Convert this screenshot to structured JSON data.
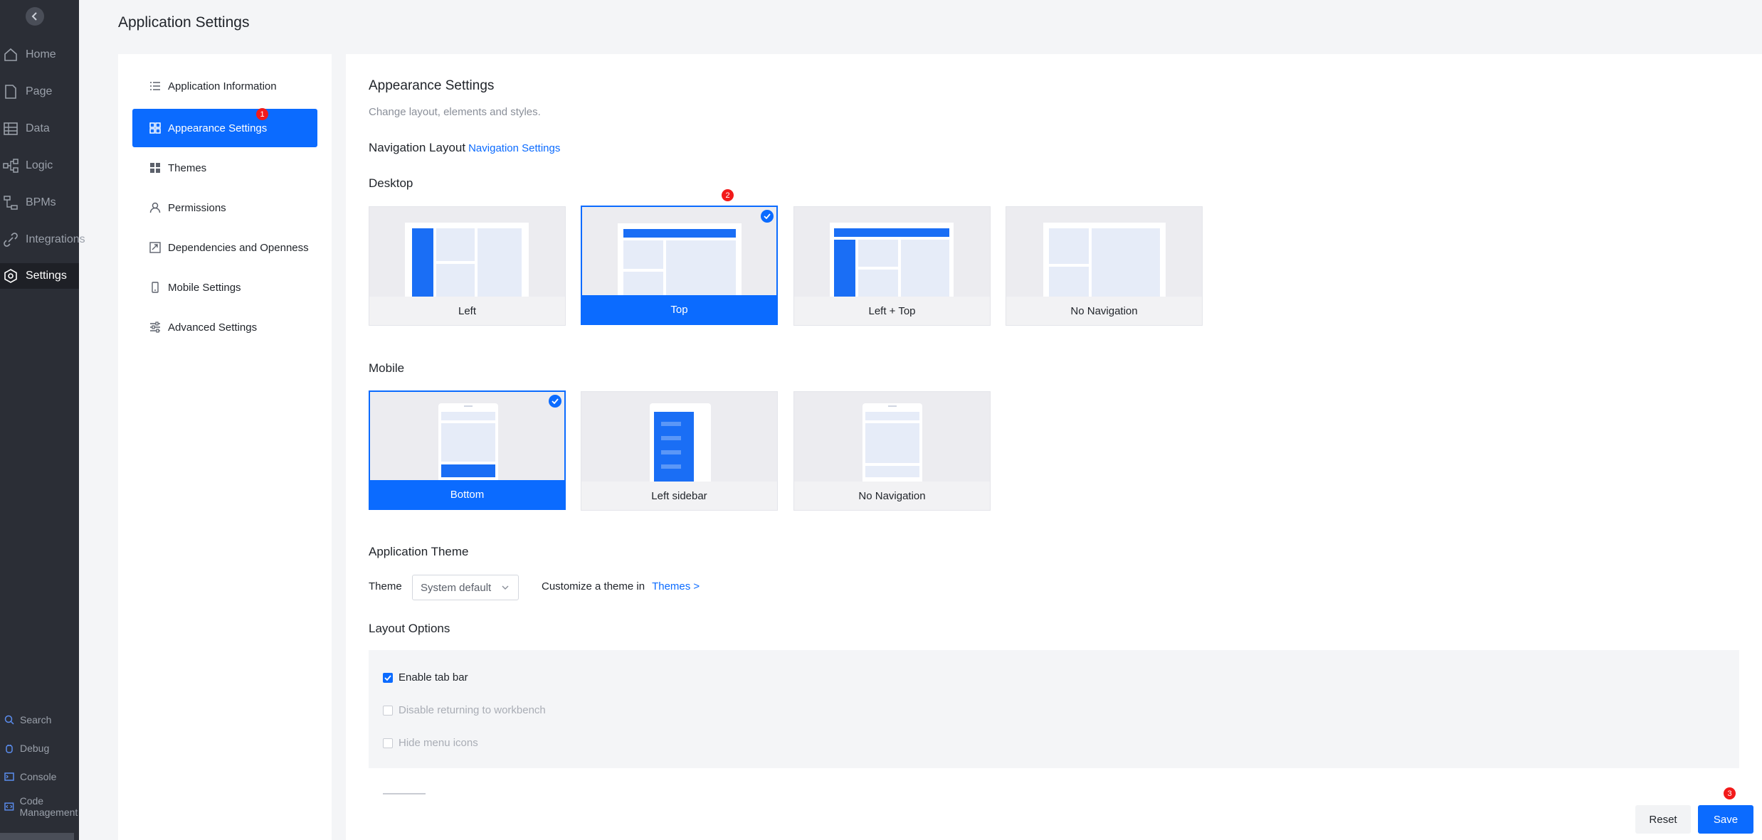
{
  "page_title": "Application Settings",
  "rail": {
    "items": [
      {
        "label": "Home",
        "icon": "home-icon"
      },
      {
        "label": "Page",
        "icon": "page-icon"
      },
      {
        "label": "Data",
        "icon": "data-icon"
      },
      {
        "label": "Logic",
        "icon": "logic-icon"
      },
      {
        "label": "BPMs",
        "icon": "bpms-icon"
      },
      {
        "label": "Integrations",
        "icon": "integrations-icon"
      },
      {
        "label": "Settings",
        "icon": "settings-icon"
      }
    ],
    "bottom": [
      {
        "label": "Search",
        "icon": "search-icon"
      },
      {
        "label": "Debug",
        "icon": "debug-icon"
      },
      {
        "label": "Console",
        "icon": "console-icon"
      },
      {
        "label": "Code Management",
        "icon": "code-management-icon"
      }
    ]
  },
  "settings_nav": {
    "items": [
      {
        "label": "Application Information",
        "icon": "list-icon"
      },
      {
        "label": "Appearance Settings",
        "icon": "layout-icon"
      },
      {
        "label": "Themes",
        "icon": "grid-icon"
      },
      {
        "label": "Permissions",
        "icon": "user-icon"
      },
      {
        "label": "Dependencies and Openness",
        "icon": "link-icon"
      },
      {
        "label": "Mobile Settings",
        "icon": "mobile-icon"
      },
      {
        "label": "Advanced Settings",
        "icon": "sliders-icon"
      }
    ],
    "active_index": 1
  },
  "annotations": {
    "badge1": "1",
    "badge2": "2",
    "badge3": "3"
  },
  "main": {
    "title": "Appearance Settings",
    "subtitle": "Change layout, elements and styles.",
    "nav_layout_label": "Navigation Layout",
    "nav_settings_link": "Navigation Settings",
    "desktop_label": "Desktop",
    "desktop_options": [
      {
        "label": "Left",
        "selected": false
      },
      {
        "label": "Top",
        "selected": true
      },
      {
        "label": "Left + Top",
        "selected": false
      },
      {
        "label": "No Navigation",
        "selected": false
      }
    ],
    "mobile_label": "Mobile",
    "mobile_options": [
      {
        "label": "Bottom",
        "selected": true
      },
      {
        "label": "Left sidebar",
        "selected": false
      },
      {
        "label": "No Navigation",
        "selected": false
      }
    ],
    "app_theme_label": "Application Theme",
    "theme_field_label": "Theme",
    "theme_value": "System default",
    "customize_text": "Customize a theme in",
    "themes_link": "Themes >",
    "layout_options_label": "Layout Options",
    "layout_options": [
      {
        "label": "Enable tab bar",
        "checked": true,
        "disabled": false
      },
      {
        "label": "Disable returning to workbench",
        "checked": false,
        "disabled": true
      },
      {
        "label": "Hide menu icons",
        "checked": false,
        "disabled": true
      }
    ],
    "reset_label": "Reset",
    "save_label": "Save"
  },
  "colors": {
    "accent": "#0b6bff",
    "rail_bg": "#2b2e36",
    "badge": "#f21a1a"
  }
}
